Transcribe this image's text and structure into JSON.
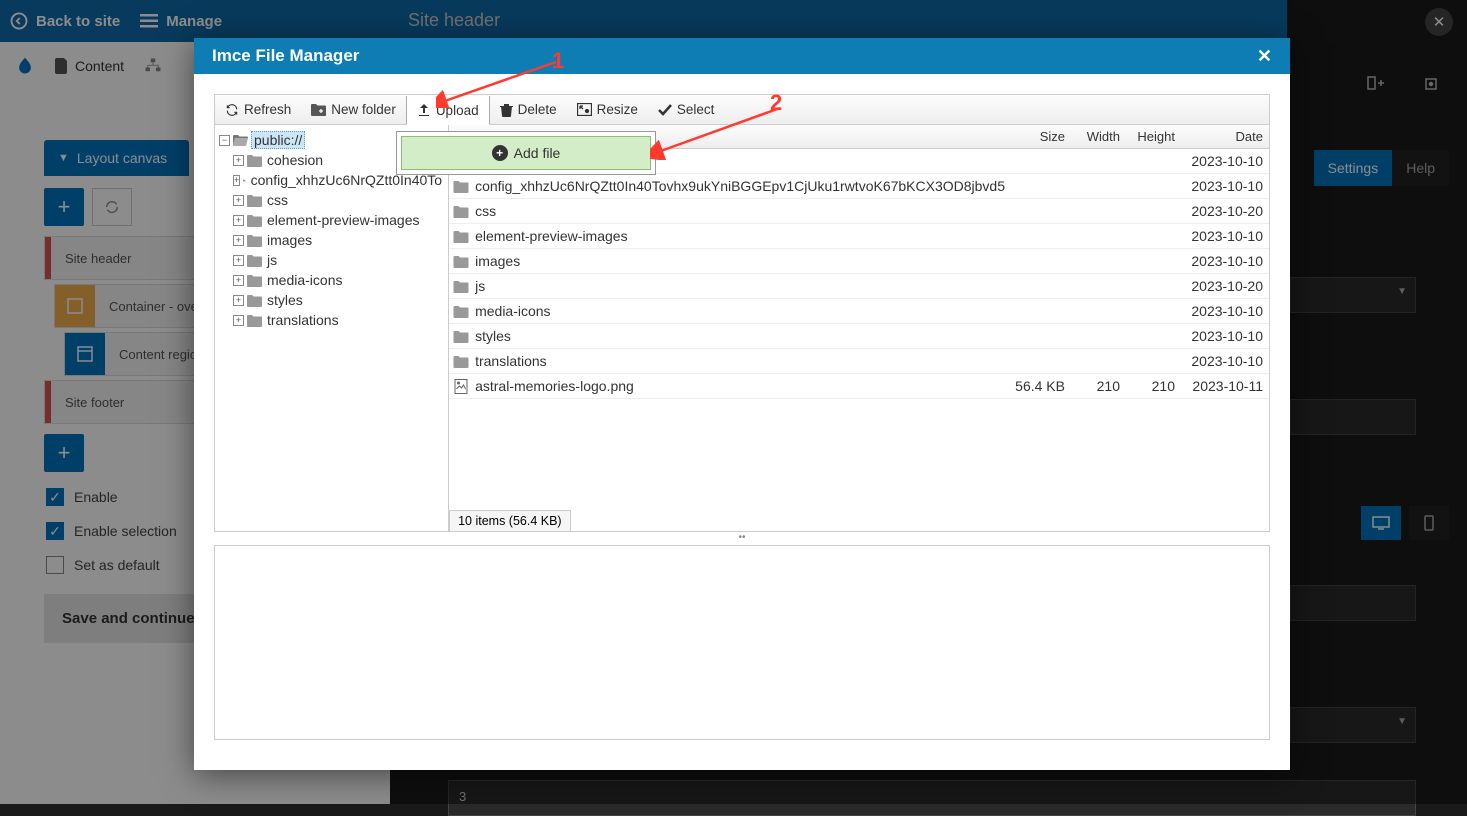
{
  "bg": {
    "back_to_site": "Back to site",
    "manage": "Manage",
    "content": "Content",
    "page_title": "Site header",
    "layout_canvas": "Layout canvas",
    "items": {
      "site_header": "Site header",
      "container": "Container - ove",
      "content_region": "Content regio",
      "site_footer": "Site footer"
    },
    "enable": "Enable",
    "enable_selection": "Enable selection",
    "set_as_default": "Set as default",
    "save": "Save and continue",
    "tabs": {
      "settings": "Settings",
      "help": "Help"
    },
    "dropdown_value": "3"
  },
  "modal": {
    "title": "Imce File Manager",
    "toolbar": {
      "refresh": "Refresh",
      "new_folder": "New folder",
      "upload": "Upload",
      "delete": "Delete",
      "resize": "Resize",
      "select": "Select"
    },
    "add_file": "Add file",
    "tree": {
      "root": "public://",
      "children": [
        "cohesion",
        "config_xhhzUc6NrQZtt0In40To",
        "css",
        "element-preview-images",
        "images",
        "js",
        "media-icons",
        "styles",
        "translations"
      ]
    },
    "list_headers": {
      "size": "Size",
      "width": "Width",
      "height": "Height",
      "date": "Date"
    },
    "files": [
      {
        "name": "",
        "type": "folder",
        "size": "",
        "w": "",
        "h": "",
        "date": "2023-10-10"
      },
      {
        "name": "config_xhhzUc6NrQZtt0In40Tovhx9ukYniBGGEpv1CjUku1rwtvoK67bKCX3OD8jbvd5",
        "type": "folder",
        "size": "",
        "w": "",
        "h": "",
        "date": "2023-10-10"
      },
      {
        "name": "css",
        "type": "folder",
        "size": "",
        "w": "",
        "h": "",
        "date": "2023-10-20"
      },
      {
        "name": "element-preview-images",
        "type": "folder",
        "size": "",
        "w": "",
        "h": "",
        "date": "2023-10-10"
      },
      {
        "name": "images",
        "type": "folder",
        "size": "",
        "w": "",
        "h": "",
        "date": "2023-10-10"
      },
      {
        "name": "js",
        "type": "folder",
        "size": "",
        "w": "",
        "h": "",
        "date": "2023-10-20"
      },
      {
        "name": "media-icons",
        "type": "folder",
        "size": "",
        "w": "",
        "h": "",
        "date": "2023-10-10"
      },
      {
        "name": "styles",
        "type": "folder",
        "size": "",
        "w": "",
        "h": "",
        "date": "2023-10-10"
      },
      {
        "name": "translations",
        "type": "folder",
        "size": "",
        "w": "",
        "h": "",
        "date": "2023-10-10"
      },
      {
        "name": "astral-memories-logo.png",
        "type": "file",
        "size": "56.4 KB",
        "w": "210",
        "h": "210",
        "date": "2023-10-11"
      }
    ],
    "status": "10 items (56.4 KB)"
  },
  "annotations": {
    "one": "1",
    "two": "2"
  }
}
